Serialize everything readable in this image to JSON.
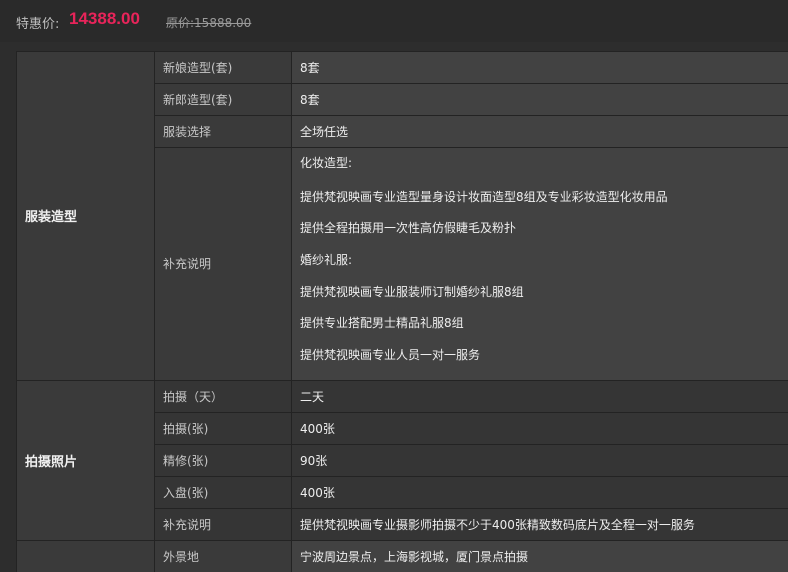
{
  "price": {
    "label": "特惠价:",
    "value": "14388.00",
    "original": "原价:15888.00"
  },
  "sections": [
    {
      "category": "服装造型",
      "rows": [
        {
          "label": "新娘造型(套)",
          "value": "8套"
        },
        {
          "label": "新郎造型(套)",
          "value": "8套"
        },
        {
          "label": "服装选择",
          "value": "全场任选"
        }
      ],
      "notes_label": "补充说明",
      "notes": [
        "化妆造型:",
        "提供梵视映画专业造型量身设计妆面造型8组及专业彩妆造型化妆用品",
        "提供全程拍摄用一次性高仿假睫毛及粉扑",
        "婚纱礼服:",
        "提供梵视映画专业服装师订制婚纱礼服8组",
        "提供专业搭配男士精品礼服8组",
        "提供梵视映画专业人员一对一服务"
      ]
    },
    {
      "category": "拍摄照片",
      "rows": [
        {
          "label": "拍摄（天）",
          "value": "二天"
        },
        {
          "label": "拍摄(张)",
          "value": "400张"
        },
        {
          "label": "精修(张)",
          "value": "90张"
        },
        {
          "label": "入盘(张)",
          "value": "400张"
        },
        {
          "label": "补充说明",
          "value": "提供梵视映画专业摄影师拍摄不少于400张精致数码底片及全程一对一服务"
        }
      ]
    },
    {
      "category": "",
      "rows": [
        {
          "label": "外景地",
          "value": "宁波周边景点，上海影视城，厦门景点拍摄"
        }
      ]
    }
  ]
}
